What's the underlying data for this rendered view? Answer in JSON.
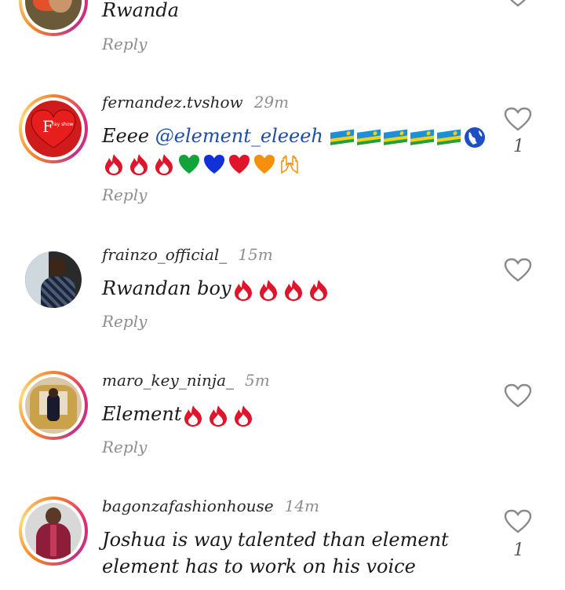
{
  "comments": [
    {
      "username": "",
      "time": "",
      "text": "Rwanda",
      "reply_label": "Reply",
      "like_count": ""
    },
    {
      "username": "fernandez.tvshow",
      "time": "29m",
      "mention": "@element_eleeeh",
      "text_prefix": "Eeee ",
      "reply_label": "Reply",
      "like_count": "1",
      "avatar_text": "Fay show"
    },
    {
      "username": "frainzo_official_",
      "time": "15m",
      "text": "Rwandan boy",
      "reply_label": "Reply",
      "like_count": ""
    },
    {
      "username": "maro_key_ninja_",
      "time": "5m",
      "text": "Element",
      "reply_label": "Reply",
      "like_count": ""
    },
    {
      "username": "bagonzafashionhouse",
      "time": "14m",
      "text_line1": "Joshua is way talented than element",
      "text_line2": "element has to work on his voice",
      "reply_label": "",
      "like_count": "1"
    }
  ],
  "icons": {
    "like": "heart-outline-icon",
    "fire": "fire-emoji",
    "flag": "rwanda-flag-emoji",
    "globe": "globe-emoji",
    "hearts": [
      "green-heart-emoji",
      "blue-heart-emoji",
      "red-heart-emoji",
      "orange-heart-emoji"
    ],
    "hands": "raised-hands-emoji"
  },
  "colors": {
    "mention": "#1e4fa3",
    "secondary_text": "#8e8e8e",
    "fire_red": "#e0142a"
  }
}
